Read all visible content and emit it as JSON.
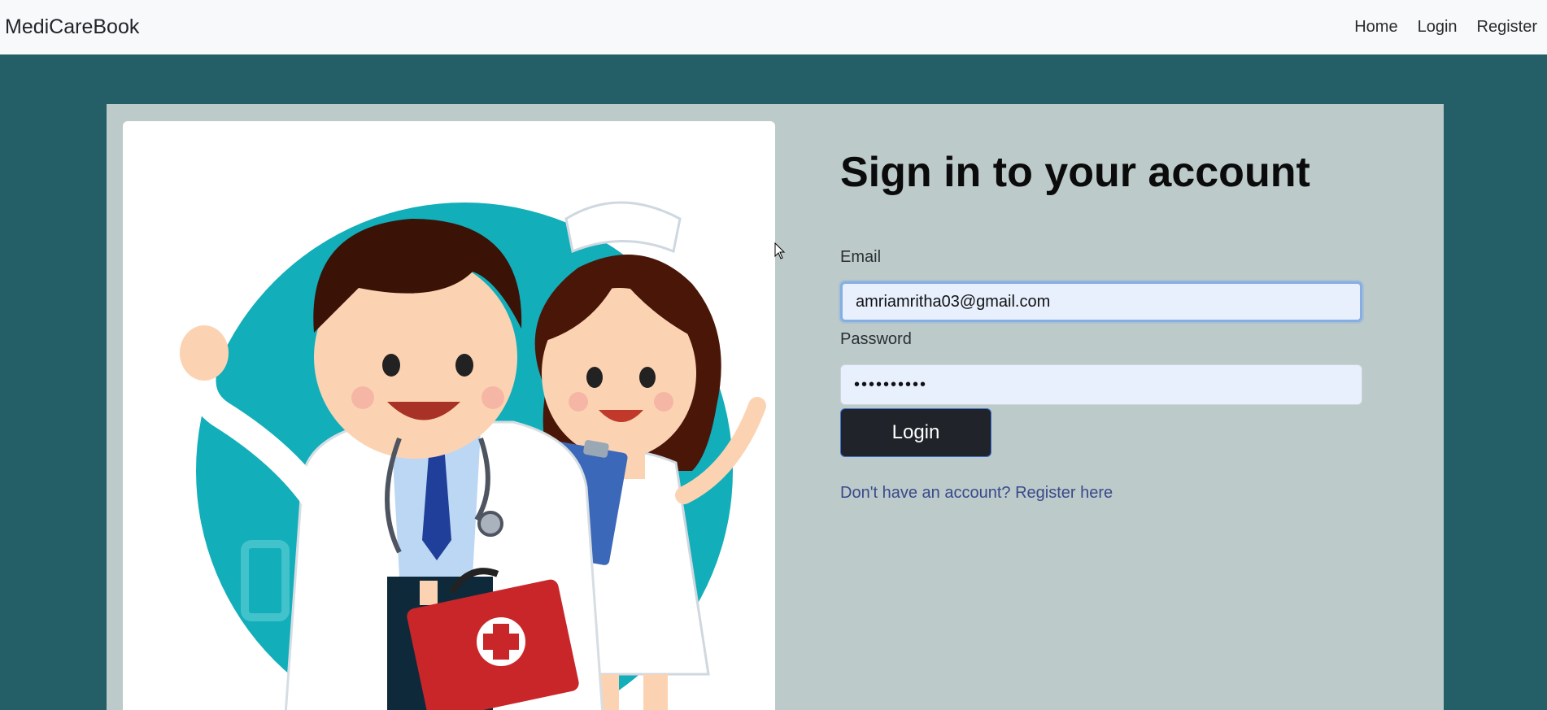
{
  "navbar": {
    "brand": "MediCareBook",
    "links": [
      "Home",
      "Login",
      "Register"
    ]
  },
  "illustration": {
    "icon": "doctor-and-nurse-illustration"
  },
  "form": {
    "title": "Sign in to your account",
    "email_label": "Email",
    "email_value": "amriamritha03@gmail.com",
    "password_label": "Password",
    "password_value": "••••••••••",
    "login_label": "Login",
    "register_text": "Don't have an account? Register here"
  },
  "colors": {
    "background": "#245e66",
    "panel": "#bccaca",
    "navbar": "#f8f9fb",
    "button": "#20242a",
    "input": "#e8f0fe",
    "link": "#3a4a8a"
  }
}
